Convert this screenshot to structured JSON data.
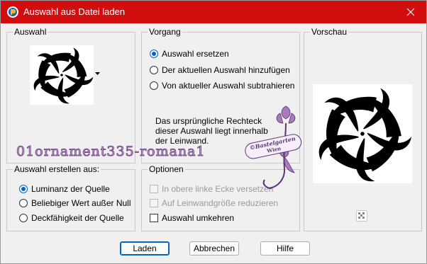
{
  "window": {
    "title": "Auswahl aus Datei laden",
    "icon": "psp-app-icon",
    "close_icon": "close-icon"
  },
  "auswahl": {
    "title": "Auswahl",
    "dropdown_icon": "dropdown-arrow-icon"
  },
  "vorgang": {
    "title": "Vorgang",
    "options": [
      {
        "label": "Auswahl ersetzen",
        "checked": true
      },
      {
        "label": "Der aktuellen Auswahl hinzufügen",
        "checked": false
      },
      {
        "label": "Von aktueller Auswahl subtrahieren",
        "checked": false
      }
    ],
    "info": "Das ursprüngliche Rechteck dieser Auswahl liegt innerhalb der Leinwand."
  },
  "vorschau": {
    "title": "Vorschau",
    "toggle_icon": "transparency-checker-icon"
  },
  "erstellen": {
    "title": "Auswahl erstellen aus:",
    "options": [
      {
        "label": "Luminanz der Quelle",
        "checked": true
      },
      {
        "label": "Beliebiger Wert außer Null",
        "checked": false
      },
      {
        "label": "Deckfähigkeit der Quelle",
        "checked": false
      }
    ]
  },
  "optionen": {
    "title": "Optionen",
    "items": [
      {
        "label": "In obere linke Ecke versetzen",
        "checked": false,
        "enabled": false
      },
      {
        "label": "Auf Leinwandgröße reduzieren",
        "checked": false,
        "enabled": false
      },
      {
        "label": "Auswahl umkehren",
        "checked": false,
        "enabled": true
      }
    ]
  },
  "buttons": {
    "load": "Laden",
    "cancel": "Abbrechen",
    "help": "Hilfe"
  },
  "overlay": {
    "filename": "01ornament335-romana1",
    "stamp_line1": "©Bastelgarten",
    "stamp_line2": "Wien"
  },
  "colors": {
    "titlebar": "#d20d0d",
    "accent": "#0066cc",
    "watermark": "#7d4f8e"
  }
}
